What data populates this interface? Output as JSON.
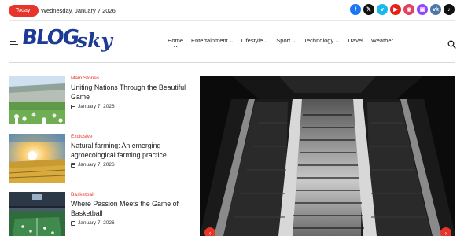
{
  "topbar": {
    "today_label": "Today:",
    "date": "Wednesday, January 7 2026",
    "socials": [
      {
        "name": "facebook-icon",
        "glyph": "f",
        "color": "#1877f2"
      },
      {
        "name": "x-icon",
        "glyph": "𝕏",
        "color": "#111111"
      },
      {
        "name": "vimeo-icon",
        "glyph": "v",
        "color": "#1ab7ea"
      },
      {
        "name": "youtube-icon",
        "glyph": "▶",
        "color": "#e62117"
      },
      {
        "name": "instagram-icon",
        "glyph": "◉",
        "color": "#e4405f"
      },
      {
        "name": "twitch-icon",
        "glyph": "▣",
        "color": "#9146ff"
      },
      {
        "name": "vk-icon",
        "glyph": "vk",
        "color": "#4a76a8"
      },
      {
        "name": "tiktok-icon",
        "glyph": "♪",
        "color": "#111111"
      }
    ]
  },
  "header": {
    "logo_main": "BLOG",
    "logo_accent": "sky",
    "nav": [
      {
        "label": "Home",
        "dropdown": false,
        "active": true
      },
      {
        "label": "Entertainment",
        "dropdown": true
      },
      {
        "label": "Lifestyle",
        "dropdown": true
      },
      {
        "label": "Sport",
        "dropdown": true
      },
      {
        "label": "Technology",
        "dropdown": true
      },
      {
        "label": "Travel",
        "dropdown": false
      },
      {
        "label": "Weather",
        "dropdown": false
      }
    ]
  },
  "posts": [
    {
      "category": "Main Stories",
      "title": "Uniting Nations Through the Beautiful Game",
      "date": "January 7, 2026"
    },
    {
      "category": "Exclusive",
      "title": "Natural farming: An emerging agroecological farming practice",
      "date": "January 7, 2026"
    },
    {
      "category": "Basketball",
      "title": "Where Passion Meets the Game of Basketball",
      "date": "January 7, 2026"
    }
  ],
  "slider": {
    "prev_glyph": "‹",
    "next_glyph": "›"
  },
  "colors": {
    "accent": "#e8352b",
    "brand": "#1d3a94"
  }
}
